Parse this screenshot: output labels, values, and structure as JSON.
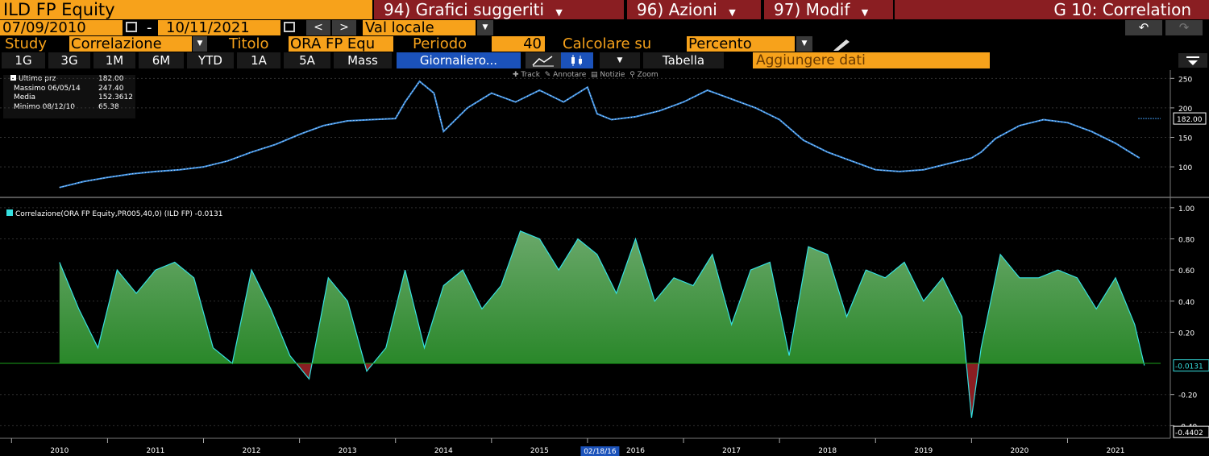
{
  "header": {
    "ticker": "ILD FP Equity",
    "menu1": "94) Grafici suggeriti",
    "menu2": "96) Azioni",
    "menu3": "97) Modif",
    "title": "G 10: Correlation"
  },
  "dates": {
    "start": "07/09/2010",
    "dash": "-",
    "end": "10/11/2021",
    "currency": "Val locale"
  },
  "study_bar": {
    "study_label": "Study",
    "study_value": "Correlazione",
    "titolo_label": "Titolo",
    "titolo_value": "ORA FP Equ",
    "periodo_label": "Periodo",
    "periodo_value": "40",
    "calc_label": "Calcolare su",
    "calc_value": "Percento"
  },
  "periods": [
    "1G",
    "3G",
    "1M",
    "6M",
    "YTD",
    "1A",
    "5A",
    "Mass"
  ],
  "frequency": "Giornaliero...",
  "tabella_label": "Tabella",
  "add_data_label": "Aggiungere dati",
  "toolbar_small": {
    "track": "Track",
    "annotate": "Annotare",
    "news": "Notizie",
    "zoom": "Zoom"
  },
  "legend_price": {
    "last_label": "Ultimo prz",
    "last_value": "182.00",
    "max_label": "Massimo 06/05/14",
    "max_value": "247.40",
    "mean_label": "Media",
    "mean_value": "152.3612",
    "min_label": "Minimo 08/12/10",
    "min_value": "65.38"
  },
  "legend_corr": "Correlazione(ORA FP Equity,PR005,40,0) (ILD FP) -0.0131",
  "cursor_date": "02/18/16",
  "colors": {
    "orange": "#f7a21b",
    "maroon": "#8a1e22",
    "price_line": "#3d8fe0",
    "corr_line": "#36e0e0",
    "corr_fill_pos": "#1e8a1e",
    "corr_fill_neg": "#8a1e22",
    "blue_btn": "#1b52ba"
  },
  "chart_data": [
    {
      "type": "line",
      "title": "",
      "series": [
        {
          "name": "Ultimo prz",
          "x": [
            2010.5,
            2010.75,
            2011.0,
            2011.25,
            2011.5,
            2011.75,
            2012.0,
            2012.25,
            2012.5,
            2012.75,
            2013.0,
            2013.25,
            2013.5,
            2013.75,
            2014.0,
            2014.1,
            2014.25,
            2014.4,
            2014.5,
            2014.75,
            2015.0,
            2015.25,
            2015.5,
            2015.75,
            2016.0,
            2016.1,
            2016.25,
            2016.5,
            2016.75,
            2017.0,
            2017.25,
            2017.5,
            2017.75,
            2018.0,
            2018.25,
            2018.5,
            2018.75,
            2019.0,
            2019.25,
            2019.5,
            2019.75,
            2020.0,
            2020.1,
            2020.25,
            2020.5,
            2020.75,
            2021.0,
            2021.25,
            2021.5,
            2021.75
          ],
          "y": [
            65,
            75,
            82,
            88,
            92,
            95,
            100,
            110,
            125,
            138,
            155,
            170,
            178,
            180,
            182,
            210,
            245,
            225,
            160,
            200,
            225,
            210,
            230,
            210,
            235,
            190,
            180,
            185,
            195,
            210,
            230,
            215,
            200,
            180,
            145,
            125,
            110,
            95,
            92,
            95,
            105,
            115,
            125,
            148,
            170,
            180,
            175,
            160,
            140,
            115
          ]
        }
      ],
      "last_value": 182.0,
      "ylim": [
        55,
        260
      ],
      "yticks": [
        100,
        150,
        200,
        250
      ],
      "x_tick_labels": [
        "2010",
        "2011",
        "2012",
        "2013",
        "2014",
        "2015",
        "2016",
        "2017",
        "2018",
        "2019",
        "2020",
        "2021"
      ]
    },
    {
      "type": "area",
      "title": "",
      "series": [
        {
          "name": "Correlazione",
          "x": [
            2010.5,
            2010.7,
            2010.9,
            2011.1,
            2011.3,
            2011.5,
            2011.7,
            2011.9,
            2012.1,
            2012.3,
            2012.5,
            2012.7,
            2012.9,
            2013.1,
            2013.3,
            2013.5,
            2013.7,
            2013.9,
            2014.1,
            2014.3,
            2014.5,
            2014.7,
            2014.9,
            2015.1,
            2015.3,
            2015.5,
            2015.7,
            2015.9,
            2016.1,
            2016.3,
            2016.5,
            2016.7,
            2016.9,
            2017.1,
            2017.3,
            2017.5,
            2017.7,
            2017.9,
            2018.1,
            2018.3,
            2018.5,
            2018.7,
            2018.9,
            2019.1,
            2019.3,
            2019.5,
            2019.7,
            2019.9,
            2020.0,
            2020.1,
            2020.3,
            2020.5,
            2020.7,
            2020.9,
            2021.1,
            2021.3,
            2021.5,
            2021.7,
            2021.8
          ],
          "y": [
            0.65,
            0.35,
            0.1,
            0.6,
            0.45,
            0.6,
            0.65,
            0.55,
            0.1,
            0.0,
            0.6,
            0.35,
            0.05,
            -0.1,
            0.55,
            0.4,
            -0.05,
            0.1,
            0.6,
            0.1,
            0.5,
            0.6,
            0.35,
            0.5,
            0.85,
            0.8,
            0.6,
            0.8,
            0.7,
            0.45,
            0.8,
            0.4,
            0.55,
            0.5,
            0.7,
            0.25,
            0.6,
            0.65,
            0.05,
            0.75,
            0.7,
            0.3,
            0.6,
            0.55,
            0.65,
            0.4,
            0.55,
            0.3,
            -0.35,
            0.1,
            0.7,
            0.55,
            0.55,
            0.6,
            0.55,
            0.35,
            0.55,
            0.25,
            -0.0131
          ]
        }
      ],
      "last_value": -0.0131,
      "min_marker": -0.4402,
      "ylim": [
        -0.45,
        1.02
      ],
      "yticks": [
        -0.4,
        -0.2,
        0.2,
        0.4,
        0.6,
        0.8,
        1.0
      ],
      "ytick_labels": [
        "-0.40",
        "-0.20",
        "0.20",
        "0.40",
        "0.60",
        "0.80",
        "1.00"
      ]
    }
  ]
}
